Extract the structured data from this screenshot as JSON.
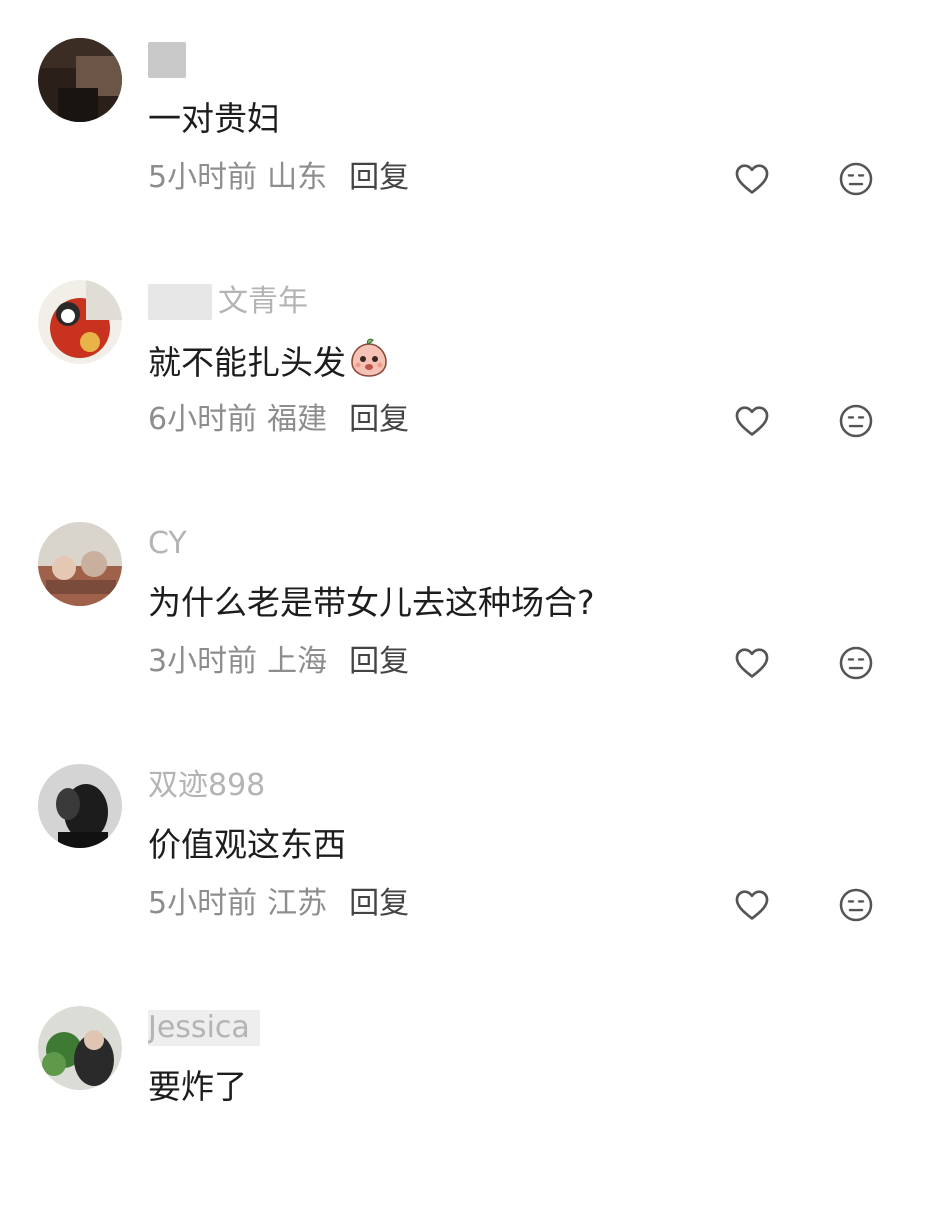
{
  "comments": [
    {
      "username": "",
      "text": "一对贵妇",
      "time": "5小时前",
      "location": "山东",
      "reply_label": "回复"
    },
    {
      "username": "文青年",
      "text": "就不能扎头发",
      "emoji": "peach-sticker",
      "time": "6小时前",
      "location": "福建",
      "reply_label": "回复"
    },
    {
      "username": "CY",
      "text": "为什么老是带女儿去这种场合?",
      "time": "3小时前",
      "location": "上海",
      "reply_label": "回复"
    },
    {
      "username": "双迹898",
      "text": "价值观这东西",
      "time": "5小时前",
      "location": "江苏",
      "reply_label": "回复"
    },
    {
      "username": "Jessica",
      "text": "要炸了",
      "time": "",
      "location": "",
      "reply_label": ""
    }
  ],
  "icons": {
    "like": "heart-outline-icon",
    "dislike": "neutral-face-icon"
  },
  "colors": {
    "text": "#1d1d1d",
    "meta": "#8d8d8d",
    "username": "#b4b4b4",
    "reply": "#444444",
    "icon": "#555555"
  }
}
